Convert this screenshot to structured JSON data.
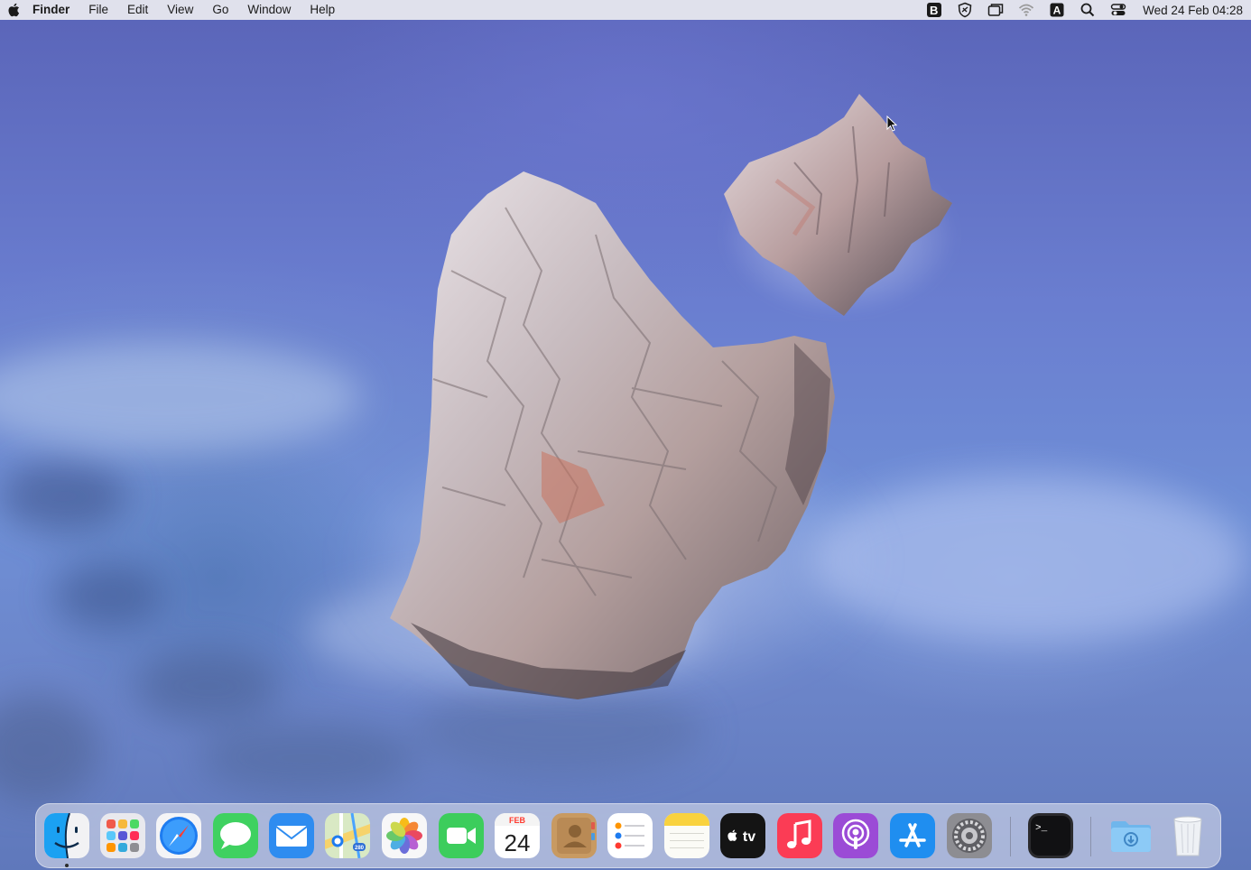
{
  "menubar": {
    "app_name": "Finder",
    "menus": [
      "File",
      "Edit",
      "View",
      "Go",
      "Window",
      "Help"
    ],
    "status_icons": [
      "bbedit-icon",
      "vpn-shield-icon",
      "screen-mirroring-icon",
      "wifi-icon",
      "input-source-icon",
      "spotlight-search-icon",
      "control-center-icon"
    ],
    "input_source_label": "A",
    "clock": "Wed 24 Feb  04:28"
  },
  "dock": {
    "apps": [
      {
        "name": "Finder",
        "icon": "finder-icon",
        "running": true
      },
      {
        "name": "Launchpad",
        "icon": "launchpad-icon"
      },
      {
        "name": "Safari",
        "icon": "safari-icon"
      },
      {
        "name": "Messages",
        "icon": "messages-icon"
      },
      {
        "name": "Mail",
        "icon": "mail-icon"
      },
      {
        "name": "Maps",
        "icon": "maps-icon"
      },
      {
        "name": "Photos",
        "icon": "photos-icon"
      },
      {
        "name": "FaceTime",
        "icon": "facetime-icon"
      },
      {
        "name": "Calendar",
        "icon": "calendar-icon"
      },
      {
        "name": "Contacts",
        "icon": "contacts-icon"
      },
      {
        "name": "Reminders",
        "icon": "reminders-icon"
      },
      {
        "name": "Notes",
        "icon": "notes-icon"
      },
      {
        "name": "TV",
        "icon": "apple-tv-icon"
      },
      {
        "name": "Music",
        "icon": "music-icon"
      },
      {
        "name": "Podcasts",
        "icon": "podcasts-icon"
      },
      {
        "name": "App Store",
        "icon": "app-store-icon"
      },
      {
        "name": "System Preferences",
        "icon": "system-preferences-icon"
      },
      {
        "name": "Terminal",
        "icon": "terminal-icon"
      },
      {
        "name": "Downloads",
        "icon": "downloads-folder-icon"
      },
      {
        "name": "Trash",
        "icon": "trash-icon"
      }
    ],
    "calendar_month": "FEB",
    "calendar_day": "24",
    "tv_label": "tv",
    "terminal_prompt": ">_",
    "maps_badge": "280"
  },
  "colors": {
    "menubar_bg": "#ececf0",
    "wallpaper_water": "#6a7ed0",
    "rock": "#b9aeae"
  }
}
